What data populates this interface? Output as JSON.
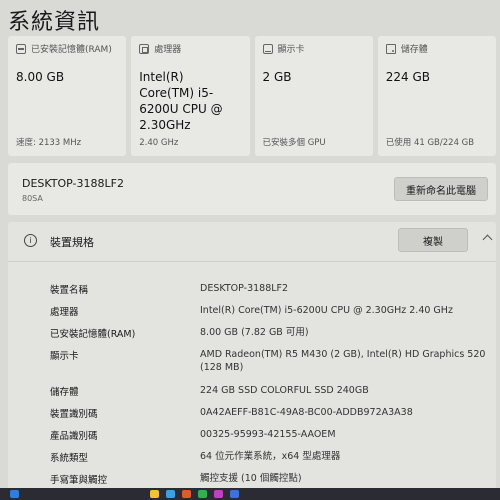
{
  "page_title": "系統資訊",
  "cards": [
    {
      "icon": "memory-icon",
      "label": "已安裝記憶體(RAM)",
      "value": "8.00 GB",
      "footer": "速度: 2133 MHz"
    },
    {
      "icon": "processor-icon",
      "label": "處理器",
      "value": "Intel(R) Core(TM) i5-6200U CPU @ 2.30GHz",
      "footer": "2.40 GHz"
    },
    {
      "icon": "display-icon",
      "label": "顯示卡",
      "value": "2 GB",
      "footer": "已安裝多個 GPU"
    },
    {
      "icon": "storage-icon",
      "label": "儲存體",
      "value": "224 GB",
      "footer": "已使用 41 GB/224 GB"
    }
  ],
  "device": {
    "name": "DESKTOP-3188LF2",
    "model": "80SA",
    "rename_label": "重新命名此電腦"
  },
  "specs": {
    "title": "裝置規格",
    "copy_label": "複製",
    "rows": [
      {
        "label": "裝置名稱",
        "value": "DESKTOP-3188LF2"
      },
      {
        "label": "處理器",
        "value": "Intel(R) Core(TM) i5-6200U CPU @ 2.30GHz   2.40 GHz"
      },
      {
        "label": "已安裝記憶體(RAM)",
        "value": "8.00 GB (7.82 GB 可用)"
      },
      {
        "label": "顯示卡",
        "value": "AMD Radeon(TM) R5 M430 (2 GB), Intel(R) HD Graphics 520 (128 MB)"
      },
      {
        "label": "儲存體",
        "value": "224 GB SSD COLORFUL SSD 240GB"
      },
      {
        "label": "裝置識別碼",
        "value": "0A42AEFF-B81C-49A8-BC00-ADDB972A3A38"
      },
      {
        "label": "產品識別碼",
        "value": "00325-95993-42155-AAOEM"
      },
      {
        "label": "系統類型",
        "value": "64 位元作業系統，x64 型處理器"
      },
      {
        "label": "手寫筆與觸控",
        "value": "觸控支援 (10 個觸控點)"
      }
    ]
  },
  "taskbar_colors": [
    "#2f7de1",
    "#f2c230",
    "#3aa0e0",
    "#e05a2a",
    "#30b050",
    "#c040c0",
    "#4070e0"
  ]
}
